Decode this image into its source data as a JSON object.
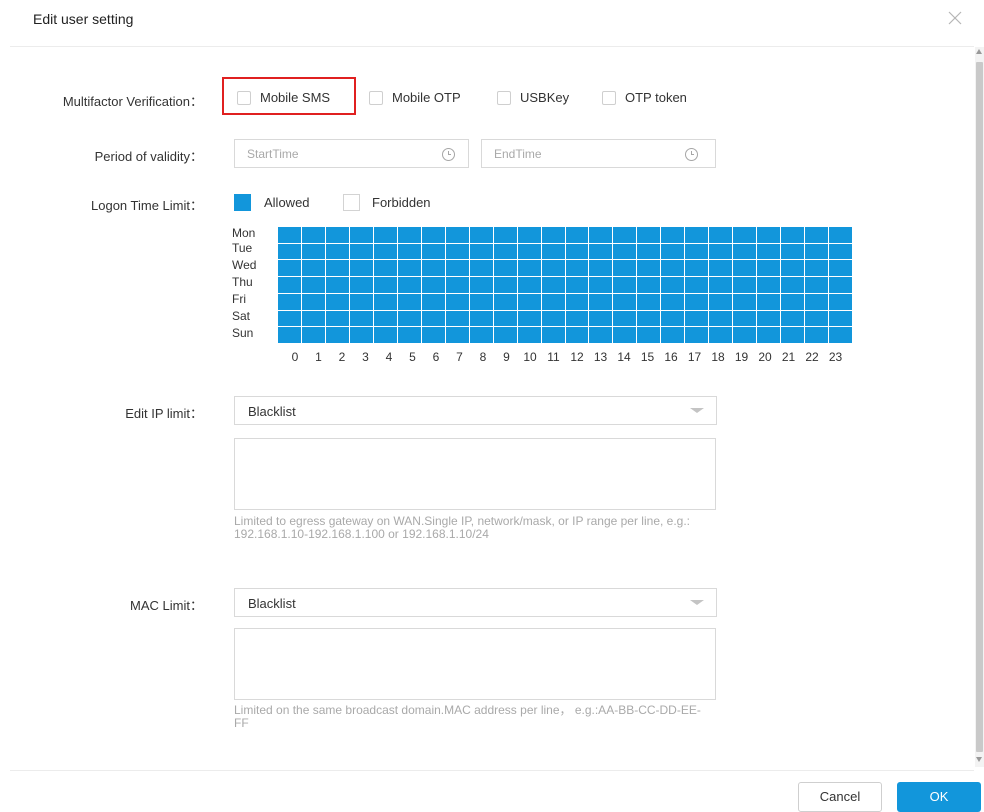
{
  "dialog": {
    "title": "Edit user setting",
    "close_icon": "close-icon"
  },
  "multifactor": {
    "label": "Multifactor Verification：",
    "options": [
      {
        "label": "Mobile SMS",
        "checked": false
      },
      {
        "label": "Mobile OTP",
        "checked": false
      },
      {
        "label": "USBKey",
        "checked": false
      },
      {
        "label": "OTP token",
        "checked": false
      }
    ]
  },
  "validity": {
    "label": "Period of validity：",
    "start_placeholder": "StartTime",
    "end_placeholder": "EndTime",
    "icon": "clock-icon"
  },
  "logon": {
    "label": "Logon Time Limit：",
    "legend_allowed": "Allowed",
    "legend_forbidden": "Forbidden",
    "allowed_color": "#1296db",
    "days": [
      "Mon",
      "Tue",
      "Wed",
      "Thu",
      "Fri",
      "Sat",
      "Sun"
    ],
    "hours": [
      "0",
      "1",
      "2",
      "3",
      "4",
      "5",
      "6",
      "7",
      "8",
      "9",
      "10",
      "11",
      "12",
      "13",
      "14",
      "15",
      "16",
      "17",
      "18",
      "19",
      "20",
      "21",
      "22",
      "23"
    ],
    "all_allowed": true
  },
  "ip_limit": {
    "label": "Edit IP limit：",
    "selected": "Blacklist",
    "value": "",
    "hint": "Limited to egress gateway on WAN.Single IP, network/mask, or IP range per line, e.g.: 192.168.1.10-192.168.1.100 or 192.168.1.10/24"
  },
  "mac_limit": {
    "label": "MAC Limit：",
    "selected": "Blacklist",
    "value": "",
    "hint": "Limited on the same broadcast domain.MAC address per line， e.g.:AA-BB-CC-DD-EE-FF"
  },
  "footer": {
    "cancel_label": "Cancel",
    "ok_label": "OK"
  },
  "colors": {
    "accent": "#1296db",
    "highlight": "#e02020"
  }
}
